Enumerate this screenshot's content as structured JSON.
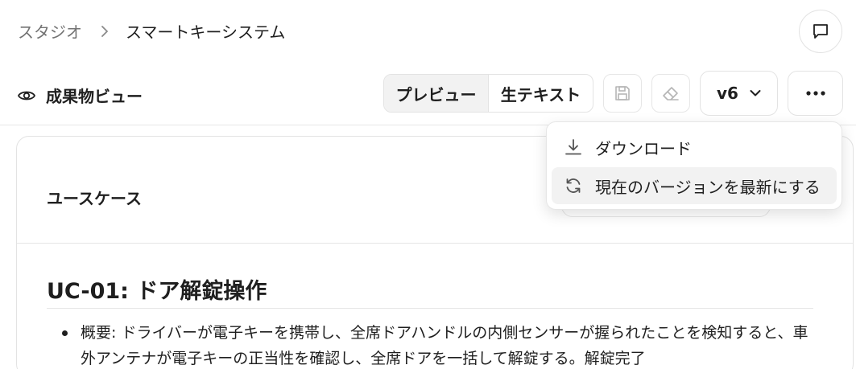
{
  "breadcrumb": {
    "root": "スタジオ",
    "current": "スマートキーシステム"
  },
  "toolbar": {
    "view_title": "成果物ビュー",
    "preview_label": "プレビュー",
    "raw_label": "生テキスト",
    "version_label": "v6"
  },
  "menu": {
    "items": [
      {
        "label": "ダウンロード",
        "icon": "download-icon"
      },
      {
        "label": "現在のバージョンを最新にする",
        "icon": "refresh-icon"
      }
    ]
  },
  "card": {
    "title": "ユースケース",
    "usecase_title": "UC-01: ドア解錠操作",
    "items": [
      "概要: ドライバーが電子キーを携帯し、全席ドアハンドルの内側センサーが握られたことを検知すると、車外アンテナが電子キーの正当性を確認し、全席ドアを一括して解錠する。解錠完了"
    ]
  },
  "icons": {
    "breadcrumb_separator": "chevron-right-icon",
    "comment": "comment-icon",
    "view": "eye-icon",
    "save": "save-icon",
    "erase": "eraser-icon",
    "version_dropdown": "chevron-down-icon",
    "more": "more-horizontal-icon"
  },
  "colors": {
    "text": "#1f1f1f",
    "muted": "#737373",
    "border": "#e3e3e3",
    "active_segment": "#f2f2f2",
    "disabled_icon": "#b5b5b5"
  }
}
